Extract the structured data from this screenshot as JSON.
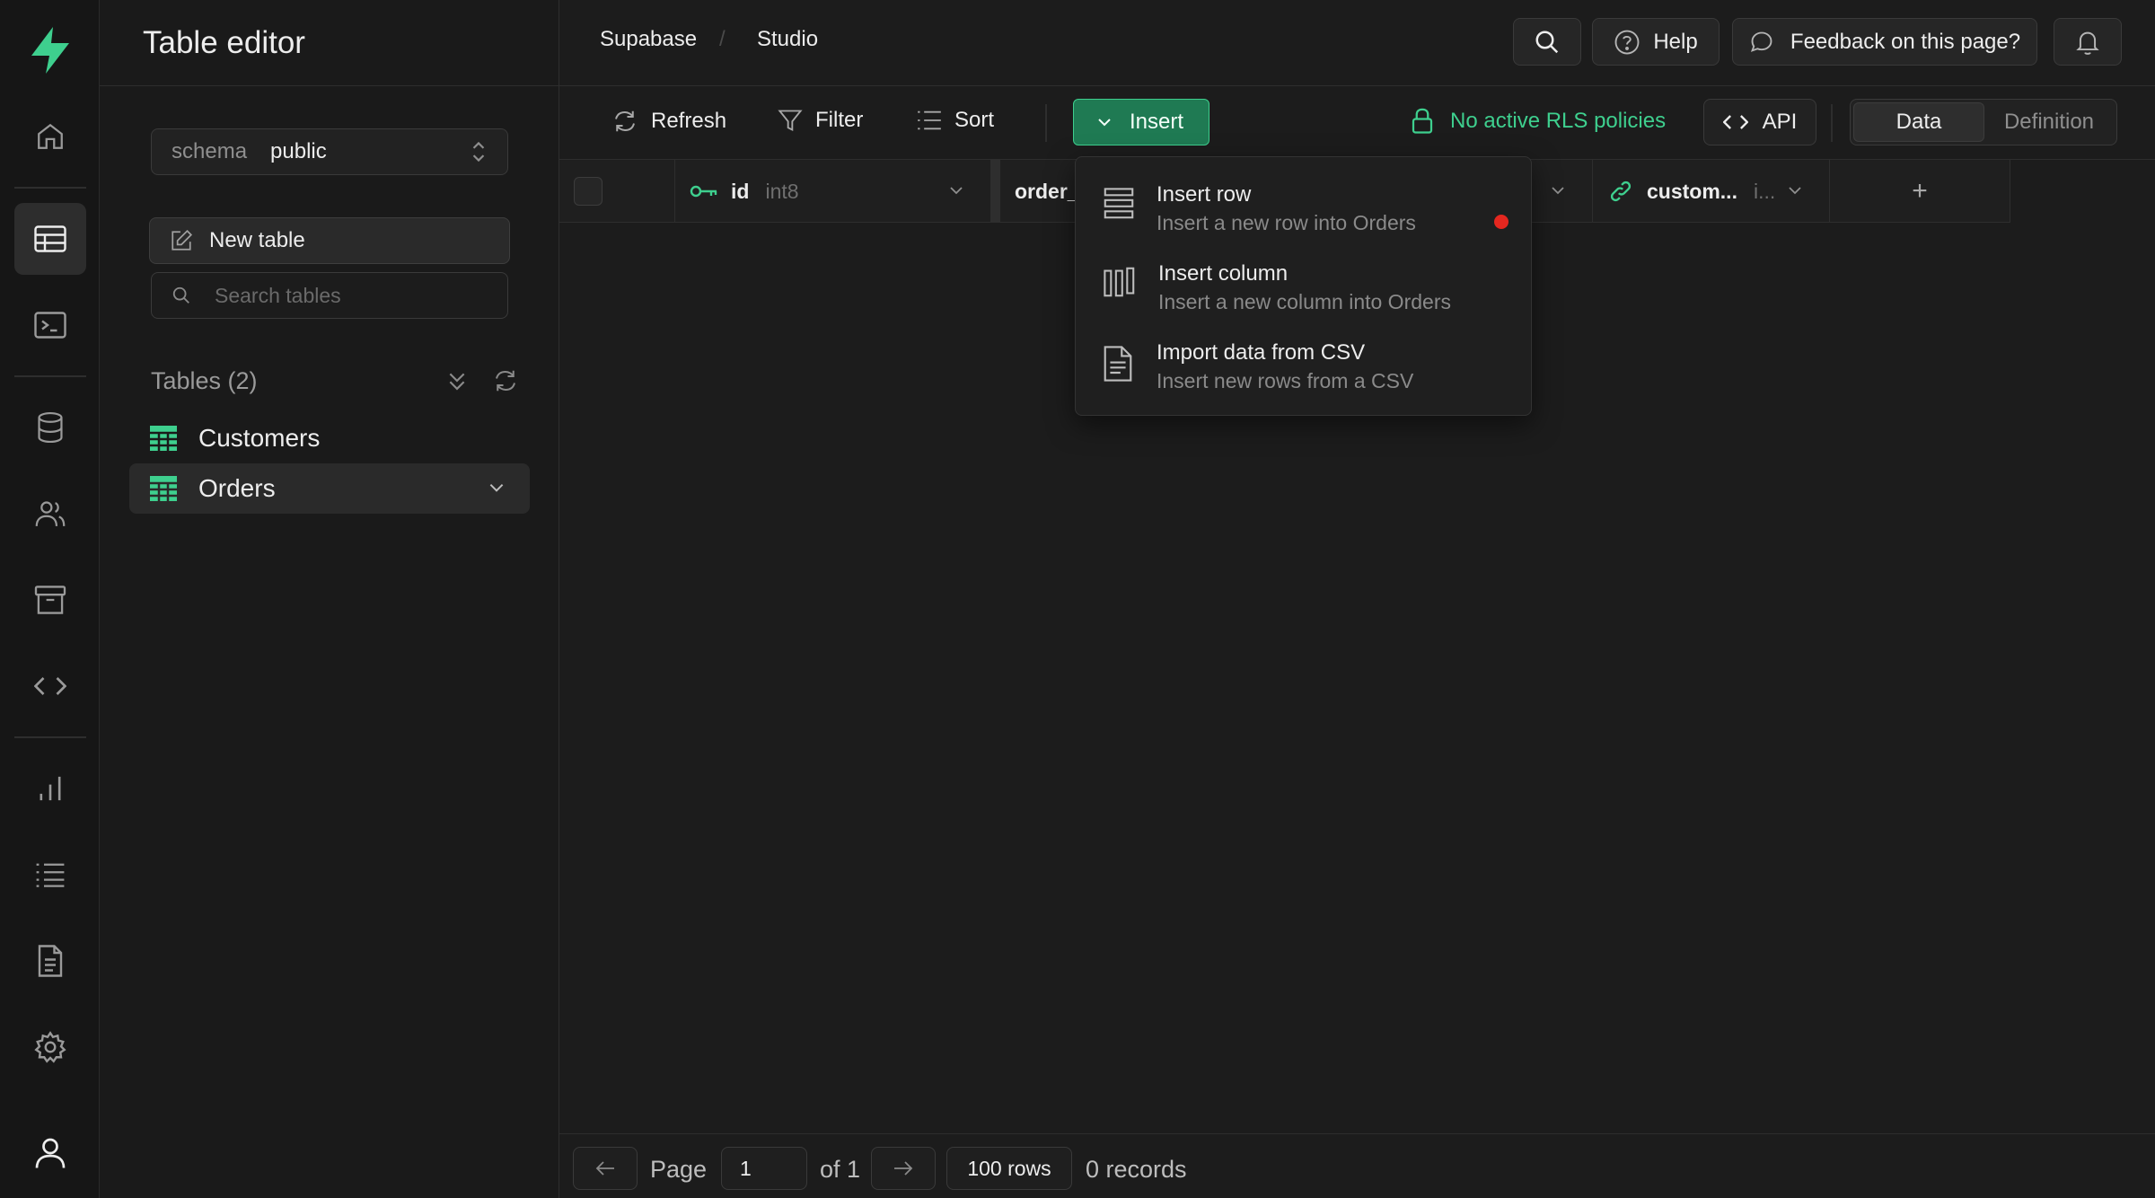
{
  "sidebar": {
    "title": "Table editor",
    "schema_label": "schema",
    "schema_value": "public",
    "new_table_label": "New table",
    "search_placeholder": "Search tables",
    "tables_heading": "Tables (2)",
    "tables": [
      {
        "name": "Customers"
      },
      {
        "name": "Orders"
      }
    ]
  },
  "topbar": {
    "breadcrumb": [
      "Supabase",
      "Studio"
    ],
    "help_label": "Help",
    "feedback_label": "Feedback on this page?"
  },
  "toolbar": {
    "refresh_label": "Refresh",
    "filter_label": "Filter",
    "sort_label": "Sort",
    "insert_label": "Insert",
    "rls_label": "No active RLS policies",
    "api_label": "API",
    "view_tabs": [
      "Data",
      "Definition"
    ],
    "active_view": "Data"
  },
  "grid": {
    "columns": [
      {
        "name": "id",
        "type": "int8",
        "key_icon": "primary-key-icon"
      },
      {
        "name": "order_",
        "type": ""
      },
      {
        "name": "custom...",
        "type": "i...",
        "key_icon": "foreign-key-link-icon"
      }
    ],
    "add_column_label": "+"
  },
  "insert_menu": {
    "items": [
      {
        "title": "Insert row",
        "subtitle": "Insert a new row into Orders",
        "icon": "rows-icon"
      },
      {
        "title": "Insert column",
        "subtitle": "Insert a new column into Orders",
        "icon": "columns-icon"
      },
      {
        "title": "Import data from CSV",
        "subtitle": "Insert new rows from a CSV",
        "icon": "file-icon"
      }
    ]
  },
  "footer": {
    "page_label": "Page",
    "page_value": "1",
    "of_label": "of 1",
    "rows_label": "100 rows",
    "records_label": "0 records"
  },
  "colors": {
    "brand_green": "#3ecf8e",
    "insert_bg": "#1f7a53",
    "background": "#1c1c1c",
    "notification_dot": "#e5271f"
  }
}
